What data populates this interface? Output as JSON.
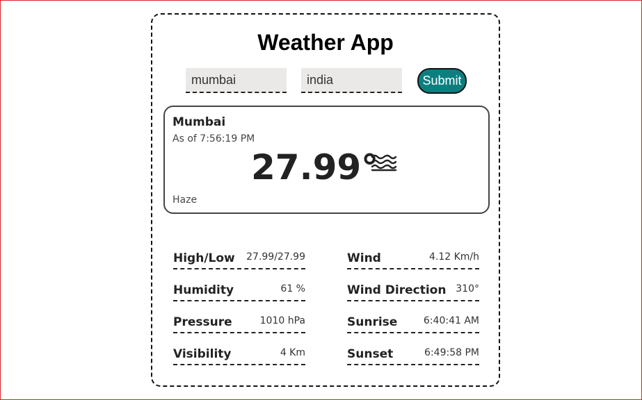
{
  "app": {
    "title": "Weather App"
  },
  "search": {
    "city_value": "mumbai",
    "country_value": "india",
    "submit_label": "Submit"
  },
  "current": {
    "city": "Mumbai",
    "as_of_prefix": "As of",
    "time": "7:56:19 PM",
    "temperature": "27.99°",
    "condition": "Haze",
    "icon": "haze-icon"
  },
  "details": {
    "left": [
      {
        "label": "High/Low",
        "value": "27.99/27.99"
      },
      {
        "label": "Humidity",
        "value": "61 %"
      },
      {
        "label": "Pressure",
        "value": "1010 hPa"
      },
      {
        "label": "Visibility",
        "value": "4 Km"
      }
    ],
    "right": [
      {
        "label": "Wind",
        "value": "4.12 Km/h"
      },
      {
        "label": "Wind Direction",
        "value": "310°"
      },
      {
        "label": "Sunrise",
        "value": "6:40:41 AM"
      },
      {
        "label": "Sunset",
        "value": "6:49:58 PM"
      }
    ]
  },
  "colors": {
    "accent": "#0b7f7f",
    "frame": "#e02020",
    "input_bg": "#ebe9e7"
  }
}
